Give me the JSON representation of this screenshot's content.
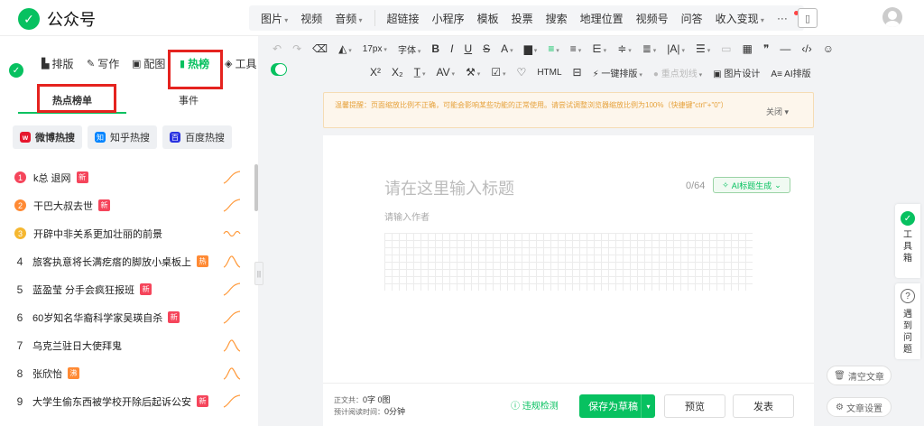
{
  "header": {
    "logo_text": "公众号",
    "menu_groups": [
      [
        {
          "label": "图片",
          "dd": true
        },
        {
          "label": "视频",
          "dd": false
        },
        {
          "label": "音频",
          "dd": true
        }
      ],
      [
        {
          "label": "超链接",
          "dd": false
        },
        {
          "label": "小程序",
          "dd": false
        },
        {
          "label": "模板",
          "dd": false
        },
        {
          "label": "投票",
          "dd": false
        },
        {
          "label": "搜索",
          "dd": false
        },
        {
          "label": "地理位置",
          "dd": false
        },
        {
          "label": "视频号",
          "dd": false
        },
        {
          "label": "问答",
          "dd": false
        },
        {
          "label": "收入变现",
          "dd": true
        },
        {
          "label": "···",
          "dd": false
        }
      ]
    ]
  },
  "panel_tabs": {
    "layout": "排版",
    "write": "写作",
    "image": "配图",
    "hot": "热榜",
    "tools": "工具"
  },
  "sub_tabs": {
    "hot_list": "热点榜单",
    "events": "事件"
  },
  "sources": [
    {
      "label": "微博热搜",
      "badge": "w",
      "color": "#e6162d",
      "active": true
    },
    {
      "label": "知乎热搜",
      "badge": "知",
      "color": "#0084ff",
      "active": false
    },
    {
      "label": "百度热搜",
      "badge": "百",
      "color": "#2932e1",
      "active": false
    }
  ],
  "hot_items": [
    {
      "rank": "1",
      "title": "k总 退网",
      "tag": "新",
      "tag_color": "#f5455b",
      "medal": "#f5455b",
      "trend": "up"
    },
    {
      "rank": "2",
      "title": "干巴大叔去世",
      "tag": "新",
      "tag_color": "#f5455b",
      "medal": "#ff8a34",
      "trend": "up"
    },
    {
      "rank": "3",
      "title": "开辟中非关系更加壮丽的前景",
      "tag": "",
      "tag_color": "",
      "medal": "#f5b730",
      "trend": "wave"
    },
    {
      "rank": "4",
      "title": "旅客执意将长满疙瘩的脚放小桌板上",
      "tag": "热",
      "tag_color": "#ff8a34",
      "medal": "",
      "trend": "peak"
    },
    {
      "rank": "5",
      "title": "蓝盈莹 分手会疯狂报班",
      "tag": "新",
      "tag_color": "#f5455b",
      "medal": "",
      "trend": "up"
    },
    {
      "rank": "6",
      "title": "60岁知名华裔科学家吴瑛自杀",
      "tag": "新",
      "tag_color": "#f5455b",
      "medal": "",
      "trend": "up"
    },
    {
      "rank": "7",
      "title": "乌克兰驻日大使拜鬼",
      "tag": "",
      "tag_color": "",
      "medal": "",
      "trend": "peak"
    },
    {
      "rank": "8",
      "title": "张欣怡",
      "tag": "沸",
      "tag_color": "#ff8a34",
      "medal": "",
      "trend": "peak"
    },
    {
      "rank": "9",
      "title": "大学生偷东西被学校开除后起诉公安",
      "tag": "新",
      "tag_color": "#f5455b",
      "medal": "",
      "trend": "up"
    }
  ],
  "toolbar": {
    "font_size": "17px",
    "font": "字体",
    "one_click": "一键排版",
    "highlight": "重点划线",
    "image_design": "图片设计",
    "ai_layout": "AI排版",
    "html": "HTML"
  },
  "notice": {
    "text": "温馨提醒：页面缩放比例不正确，可能会影响某些功能的正常使用。请尝试调整浏览器缩放比例为100%（快捷键\"ctrl\"+\"0\"）",
    "close": "关闭"
  },
  "editor": {
    "title_placeholder": "请在这里输入标题",
    "title_count": "0/64",
    "ai_title": "AI标题生成",
    "author_placeholder": "请输入作者"
  },
  "footer": {
    "word_count_label": "正文共：",
    "word_count": "0字 0图",
    "read_time_label": "预计阅读时间：",
    "read_time": "0分钟",
    "check": "违规检测",
    "save": "保存为草稿",
    "preview": "预览",
    "publish": "发表"
  },
  "side": {
    "toolbox": [
      "工",
      "具",
      "箱"
    ],
    "help": [
      "遇",
      "到",
      "问",
      "题"
    ],
    "clear": "清空文章",
    "settings": "文章设置"
  }
}
